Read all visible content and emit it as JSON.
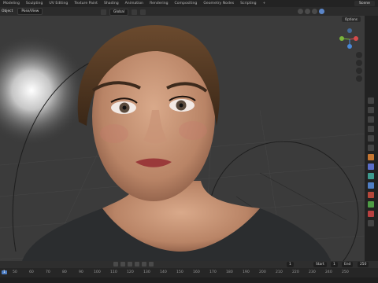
{
  "topbar": {
    "workspaces": [
      "Modeling",
      "Sculpting",
      "UV Editing",
      "Texture Paint",
      "Shading",
      "Animation",
      "Rendering",
      "Compositing",
      "Geometry Nodes",
      "Scripting"
    ],
    "scene_label": "Scene"
  },
  "header": {
    "mode_label": "Object",
    "pose_label": "Pose/View",
    "orientation_label": "Global",
    "options_label": "Options"
  },
  "timeline": {
    "start_label": "Start",
    "start_value": "1",
    "end_label": "End",
    "end_value": "250",
    "current_frame": "1",
    "ruler_ticks": [
      "50",
      "60",
      "70",
      "80",
      "90",
      "100",
      "110",
      "120",
      "130",
      "140",
      "150",
      "160",
      "170",
      "180",
      "190",
      "200",
      "210",
      "220",
      "230",
      "240",
      "250"
    ]
  },
  "colors": {
    "viewport_bg": "#3b3b3b",
    "accent": "#4f7fc5"
  }
}
